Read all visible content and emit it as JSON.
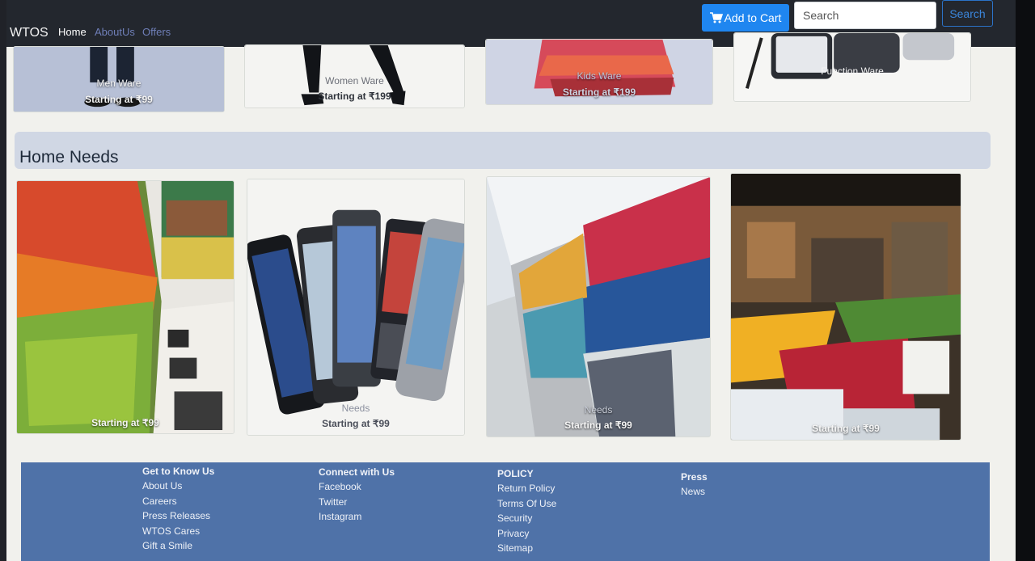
{
  "navbar": {
    "brand": "WTOS",
    "links": [
      "Home",
      "AboutUs",
      "Offers"
    ],
    "cart_label": "Add to Cart",
    "search_placeholder": "Search",
    "search_button": "Search"
  },
  "top_cards": [
    {
      "label": "Men Ware",
      "price": "Starting at ₹99"
    },
    {
      "label": "Women Ware",
      "price": "Starting at ₹199"
    },
    {
      "label": "Kids Ware",
      "price": "Starting at ₹199"
    },
    {
      "label": "Function Ware",
      "price": ""
    }
  ],
  "section": {
    "title": "Home Needs"
  },
  "home_needs": [
    {
      "label": "",
      "price": "Starting at ₹99"
    },
    {
      "label": "Needs",
      "price": "Starting at ₹99"
    },
    {
      "label": "Needs",
      "price": "Starting at ₹99"
    },
    {
      "label": "",
      "price": "Starting at ₹99"
    }
  ],
  "footer": {
    "columns": [
      {
        "heading": "Get to Know Us",
        "links": [
          "About Us",
          "Careers",
          "Press Releases",
          "WTOS Cares",
          "Gift a Smile"
        ]
      },
      {
        "heading": "Connect with Us",
        "links": [
          "Facebook",
          "Twitter",
          "Instagram"
        ]
      },
      {
        "heading": "POLICY",
        "links": [
          "Return Policy",
          "Terms Of Use",
          "Security",
          "Privacy",
          "Sitemap"
        ]
      },
      {
        "heading": "Press",
        "links": [
          "News"
        ]
      }
    ]
  }
}
